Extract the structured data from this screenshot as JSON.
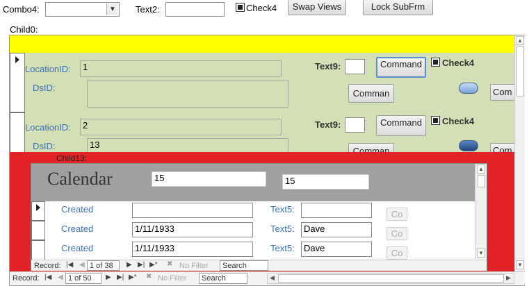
{
  "top": {
    "combo_label": "Combo4:",
    "combo_value": "",
    "text2_label": "Text2:",
    "text2_value": "",
    "check_label": "Check4",
    "swap_button": "Swap Views",
    "lock_button": "Lock SubFrm"
  },
  "child0": {
    "label": "Child0:",
    "records": [
      {
        "location_label": "LocationID:",
        "location_value": "1",
        "dsid_label": "DsID:",
        "dsid_value": "",
        "text9_label": "Text9:",
        "text9_value": "",
        "command_button": "Command",
        "check_label": "Check4",
        "comman_button": "Comman",
        "com_button": "Com"
      },
      {
        "location_label": "LocationID:",
        "location_value": "2",
        "dsid_label": "DsID:",
        "dsid_value": "13",
        "text9_label": "Text9:",
        "text9_value": "",
        "command_button": "Command",
        "check_label": "Check4",
        "comman_button": "Comman",
        "com_button": "Com"
      }
    ],
    "nav": {
      "record_label": "Record:",
      "position": "1 of 50",
      "no_filter": "No Filter",
      "search": "Search"
    }
  },
  "child13": {
    "label": "Child13:",
    "header_title": "Calendar",
    "header_field1": "15",
    "header_field2": "15",
    "rows": [
      {
        "created_label": "Created",
        "created_value": "",
        "text5_label": "Text5:",
        "text5_value": "",
        "co_button": "Co"
      },
      {
        "created_label": "Created",
        "created_value": "1/11/1933",
        "text5_label": "Text5:",
        "text5_value": "Dave",
        "co_button": "Co"
      },
      {
        "created_label": "Created",
        "created_value": "1/11/1933",
        "text5_label": "Text5:",
        "text5_value": "Dave",
        "co_button": "Co"
      }
    ],
    "nav": {
      "record_label": "Record:",
      "position": "1 of 38",
      "no_filter": "No Filter",
      "search": "Search"
    }
  },
  "colors": {
    "yellow_header": "#ffff00",
    "detail_green": "#d3dfb5",
    "subform_red": "#e32227",
    "calendar_header": "#a0a0a0",
    "label_blue": "#3a6fb5"
  },
  "icons": [
    "dropdown-arrow-icon",
    "record-selector-arrow-icon",
    "nav-first-icon",
    "nav-prev-icon",
    "nav-next-icon",
    "nav-last-icon",
    "nav-new-icon",
    "filter-icon",
    "scroll-up-icon",
    "scroll-down-icon",
    "scroll-left-icon",
    "scroll-right-icon"
  ]
}
